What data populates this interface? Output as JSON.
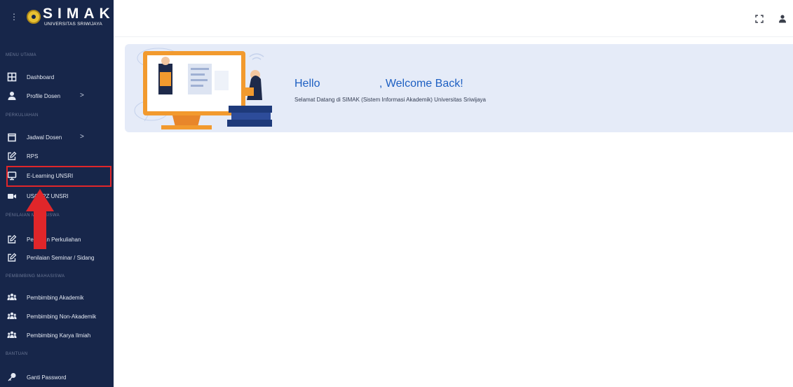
{
  "brand": {
    "title": "SIMAK",
    "subtitle": "UNIVERSITAS SRIWIJAYA"
  },
  "sidebar": {
    "sections": [
      {
        "label": "MENU UTAMA"
      },
      {
        "label": "PERKULIAHAN"
      },
      {
        "label": "PENILAIAN MAHASISWA"
      },
      {
        "label": "PEMBIMBING MAHASISWA"
      },
      {
        "label": "BANTUAN"
      }
    ],
    "items": [
      {
        "label": "Dashboard",
        "icon": "dashboard-icon"
      },
      {
        "label": "Profile Dosen",
        "icon": "user-icon",
        "chevron": ">"
      },
      {
        "label": "Jadwal Dosen",
        "icon": "calendar-icon",
        "chevron": ">"
      },
      {
        "label": "RPS",
        "icon": "edit-icon"
      },
      {
        "label": "E-Learning UNSRI",
        "icon": "monitor-icon"
      },
      {
        "label": "USCAPZ UNSRI",
        "icon": "video-icon"
      },
      {
        "label": "Penilaian Perkuliahan",
        "icon": "edit-icon"
      },
      {
        "label": "Penilaian Seminar / Sidang",
        "icon": "edit-icon"
      },
      {
        "label": "Pembimbing Akademik",
        "icon": "users-icon"
      },
      {
        "label": "Pembimbing Non-Akademik",
        "icon": "users-icon"
      },
      {
        "label": "Pembimbing Karya Ilmiah",
        "icon": "users-icon"
      },
      {
        "label": "Ganti Password",
        "icon": "key-icon"
      }
    ]
  },
  "banner": {
    "greeting": "Hello                   , Welcome Back!",
    "subtitle": "Selamat Datang di SIMAK (Sistem Informasi Akademik) Universitas Sriwijaya"
  },
  "colors": {
    "sidebar_bg": "#17264a",
    "banner_bg": "#e5ebf8",
    "greeting": "#1d5fc2",
    "highlight": "#e0262a"
  }
}
